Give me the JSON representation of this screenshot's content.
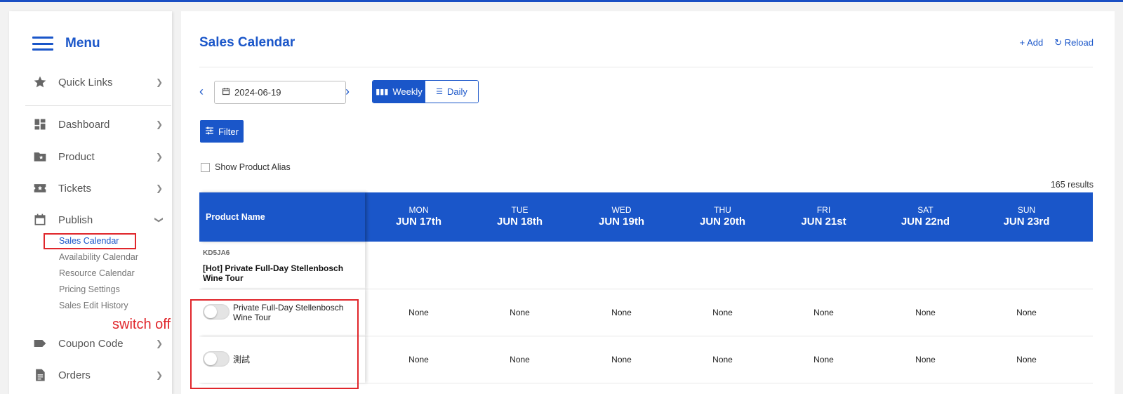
{
  "sidebar": {
    "title": "Menu",
    "items": [
      {
        "label": "Quick Links",
        "icon": "star-icon"
      },
      {
        "label": "Dashboard",
        "icon": "dashboard-icon"
      },
      {
        "label": "Product",
        "icon": "product-folder-icon"
      },
      {
        "label": "Tickets",
        "icon": "ticket-icon"
      },
      {
        "label": "Publish",
        "icon": "calendar-icon"
      },
      {
        "label": "Coupon Code",
        "icon": "tag-icon"
      },
      {
        "label": "Orders",
        "icon": "document-icon"
      }
    ],
    "publish_sub": [
      {
        "label": "Sales Calendar",
        "active": true
      },
      {
        "label": "Availability Calendar"
      },
      {
        "label": "Resource Calendar"
      },
      {
        "label": "Pricing Settings"
      },
      {
        "label": "Sales Edit History"
      }
    ]
  },
  "header": {
    "title": "Sales Calendar",
    "add_label": "Add",
    "reload_label": "Reload"
  },
  "toolbar": {
    "date_value": "2024-06-19",
    "weekly_label": "Weekly",
    "daily_label": "Daily",
    "filter_label": "Filter",
    "show_alias_label": "Show Product Alias",
    "results_text": "165 results"
  },
  "table": {
    "product_col_header": "Product Name",
    "days": [
      {
        "dow": "MON",
        "date": "JUN 17th"
      },
      {
        "dow": "TUE",
        "date": "JUN 18th"
      },
      {
        "dow": "WED",
        "date": "JUN 19th"
      },
      {
        "dow": "THU",
        "date": "JUN 20th"
      },
      {
        "dow": "FRI",
        "date": "JUN 21st"
      },
      {
        "dow": "SAT",
        "date": "JUN 22nd"
      },
      {
        "dow": "SUN",
        "date": "JUN 23rd"
      }
    ],
    "product": {
      "code": "KD5JA6",
      "name": "[Hot] Private Full-Day Stellenbosch Wine Tour"
    },
    "options": [
      {
        "name": "Private Full-Day Stellenbosch Wine Tour",
        "enabled": false,
        "cells": [
          "None",
          "None",
          "None",
          "None",
          "None",
          "None",
          "None"
        ]
      },
      {
        "name": "測試",
        "enabled": false,
        "cells": [
          "None",
          "None",
          "None",
          "None",
          "None",
          "None",
          "None"
        ]
      }
    ]
  },
  "annotation": {
    "text": "switch off",
    "color": "#e0262b"
  },
  "colors": {
    "primary": "#1a56c9",
    "annotation_red": "#e0262b"
  }
}
